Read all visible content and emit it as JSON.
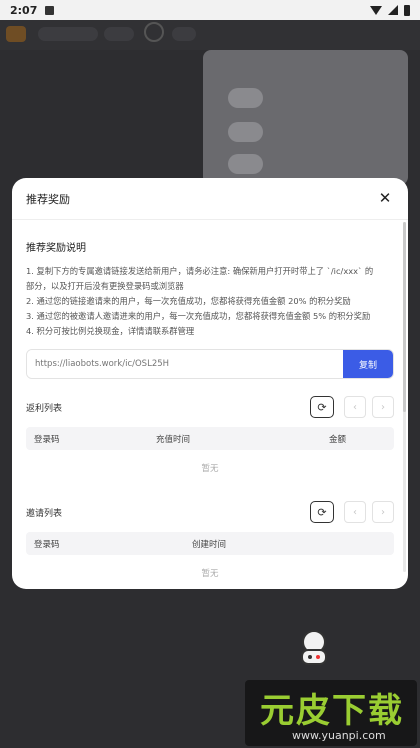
{
  "status_bar": {
    "time": "2:07"
  },
  "modal": {
    "title": "推荐奖励",
    "close_icon": "close-icon",
    "rules_heading": "推荐奖励说明",
    "rules": [
      "1. 复制下方的专属邀请链接发送给新用户，请务必注意: 确保新用户打开时带上了 `/ic/xxx` 的",
      "部分，以及打开后没有更换登录码或浏览器",
      "2. 通过您的链接邀请来的用户，每一次充值成功，您都将获得充值金额 20% 的积分奖励",
      "3. 通过您的被邀请人邀请进来的用户，每一次充值成功，您都将获得充值金额 5% 的积分奖励",
      "4. 积分可按比例兑换现金，详情请联系群管理"
    ],
    "invite_link_placeholder": "https://liaobots.work/ic/OSL25H",
    "copy_label": "复制",
    "rebate": {
      "title": "返利列表",
      "columns": [
        "登录码",
        "充值时间",
        "金额"
      ],
      "empty": "暂无"
    },
    "invite": {
      "title": "邀请列表",
      "columns": [
        "登录码",
        "创建时间"
      ],
      "empty": "暂无"
    },
    "refresh_icon": "refresh-icon",
    "prev_icon": "chevron-left-icon",
    "next_icon": "chevron-right-icon"
  },
  "watermark": {
    "text": "元皮下载",
    "url": "www.yuanpi.com"
  },
  "colors": {
    "accent": "#3b5ce6",
    "overlay": "#2d2d30"
  }
}
